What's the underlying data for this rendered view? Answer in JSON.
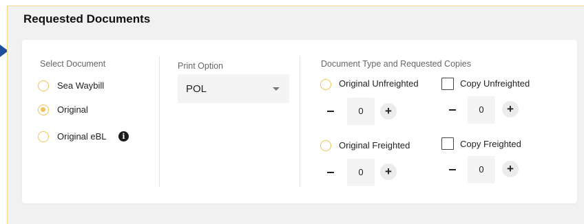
{
  "section": {
    "title": "Requested Documents"
  },
  "select_document": {
    "label": "Select Document",
    "options": [
      {
        "label": "Sea Waybill",
        "checked": false
      },
      {
        "label": "Original",
        "checked": true
      },
      {
        "label": "Original eBL",
        "checked": false,
        "info_icon": "info-icon"
      }
    ]
  },
  "print_option": {
    "label": "Print Option",
    "value": "POL"
  },
  "document_type": {
    "label": "Document Type and Requested Copies",
    "original_unfreighted": {
      "label": "Original Unfreighted",
      "value": "0"
    },
    "copy_unfreighted": {
      "label": "Copy Unfreighted",
      "value": "0"
    },
    "original_freighted": {
      "label": "Original Freighted",
      "value": "0"
    },
    "copy_freighted": {
      "label": "Copy Freighted",
      "value": "0"
    },
    "minus_symbol": "−",
    "plus_symbol": "+"
  },
  "colors": {
    "accent": "#f0c350",
    "border": "#f0d98a",
    "arrow": "#1f4e9c"
  }
}
